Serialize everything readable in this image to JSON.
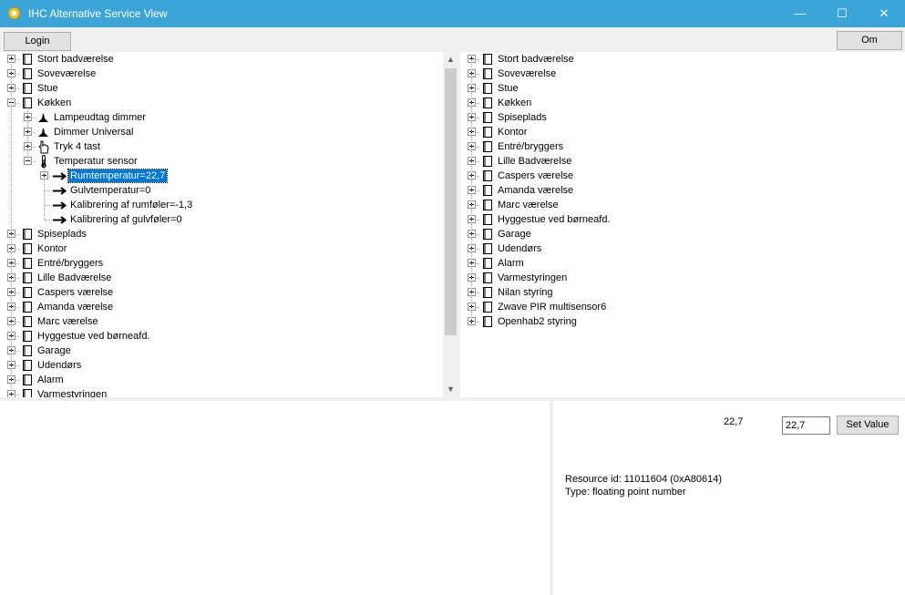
{
  "window": {
    "title": "IHC Alternative Service View",
    "controls": {
      "minimize": "—",
      "maximize": "☐",
      "close": "✕"
    }
  },
  "toolbar": {
    "login_label": "Login",
    "about_label": "Om"
  },
  "left_tree": {
    "top_rooms": [
      "Stort badværelse",
      "Soveværelse",
      "Stue"
    ],
    "expanded_room": "Køkken",
    "devices": [
      "Lampeudtag dimmer",
      "Dimmer Universal",
      "Tryk 4 tast"
    ],
    "expanded_device": "Temperatur sensor",
    "values": [
      "Rumtemperatur=22,7",
      "Gulvtemperatur=0",
      "Kalibrering af rumføler=-1,3",
      "Kalibrering af gulvføler=0"
    ],
    "bottom_rooms": [
      "Spiseplads",
      "Kontor",
      "Entré/bryggers",
      "Lille Badværelse",
      "Caspers værelse",
      "Amanda værelse",
      "Marc værelse",
      "Hyggestue ved børneafd.",
      "Garage",
      "Udendørs",
      "Alarm",
      "Varmestyringen"
    ]
  },
  "right_tree": {
    "rooms": [
      "Stort badværelse",
      "Soveværelse",
      "Stue",
      "Køkken",
      "Spiseplads",
      "Kontor",
      "Entré/bryggers",
      "Lille Badværelse",
      "Caspers værelse",
      "Amanda værelse",
      "Marc værelse",
      "Hyggestue ved børneafd.",
      "Garage",
      "Udendørs",
      "Alarm",
      "Varmestyringen",
      "Nilan styring",
      "Zwave PIR multisensor6",
      "Openhab2 styring"
    ]
  },
  "detail": {
    "current_value": "22,7",
    "input_value": "22,7",
    "set_value_label": "Set Value",
    "resource_id": "Resource id: 11011604 (0xA80614)",
    "type": "Type: floating point number"
  },
  "scrollbar": {
    "up": "▲",
    "down": "▼"
  }
}
